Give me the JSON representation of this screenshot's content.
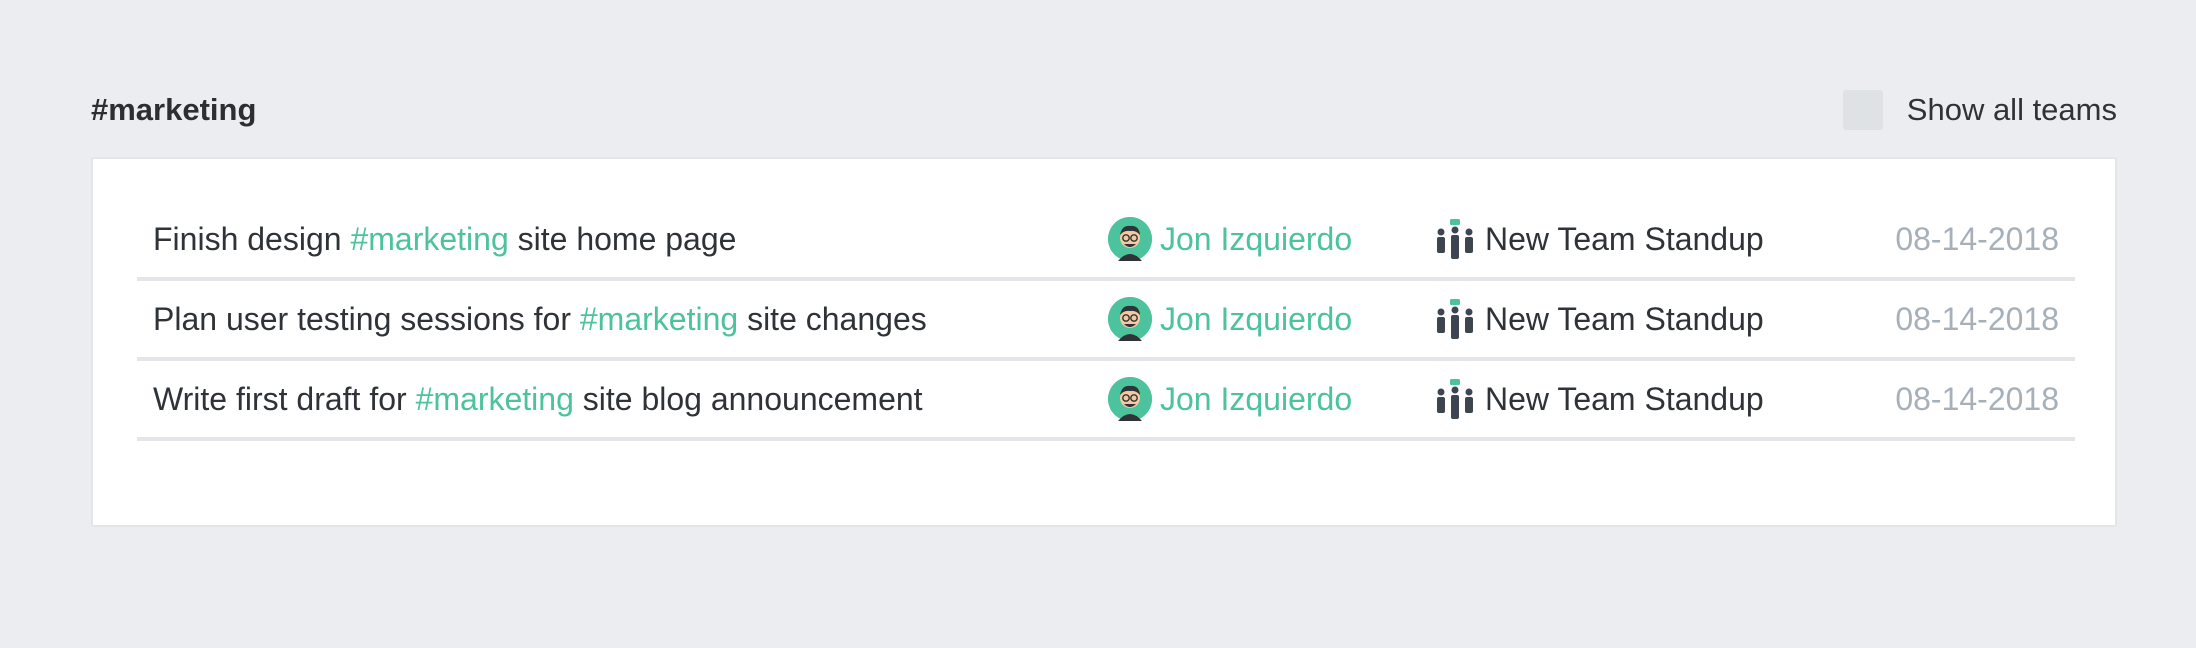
{
  "header": {
    "channel_title": "#marketing",
    "show_all_label": "Show all teams",
    "show_all_checked": false
  },
  "colors": {
    "accent": "#4cc29d",
    "date": "#a7b0b9",
    "background": "#ecedf0"
  },
  "tasks": [
    {
      "before": "Finish design ",
      "hashtag": "#marketing",
      "after": " site home page",
      "user": "Jon Izquierdo",
      "standup": "New Team Standup",
      "date": "08-14-2018"
    },
    {
      "before": "Plan user testing sessions for ",
      "hashtag": "#marketing",
      "after": " site changes",
      "user": "Jon Izquierdo",
      "standup": "New Team Standup",
      "date": "08-14-2018"
    },
    {
      "before": "Write first draft for ",
      "hashtag": "#marketing",
      "after": " site blog announcement",
      "user": "Jon Izquierdo",
      "standup": "New Team Standup",
      "date": "08-14-2018"
    }
  ]
}
